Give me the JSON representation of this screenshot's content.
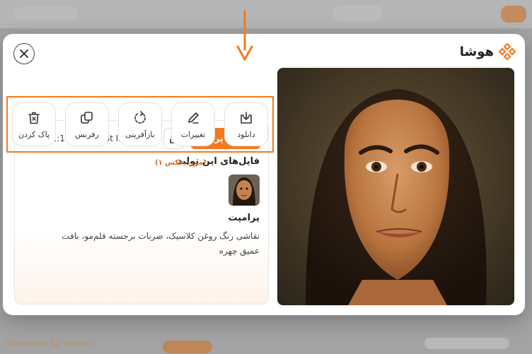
{
  "watermark": "Generated by Hoosha",
  "modal": {
    "logo_text": "هوشا",
    "toolbar": [
      {
        "icon": "download-icon",
        "label": "دانلود"
      },
      {
        "icon": "pencil-icon",
        "label": "تغییرات"
      },
      {
        "icon": "regenerate-icon",
        "label": "بازآفرینی"
      },
      {
        "icon": "reference-icon",
        "label": "رفرنس"
      },
      {
        "icon": "trash-icon",
        "label": "پاک کردن"
      }
    ],
    "copy_prompt_label": "کپی پرامپت",
    "meta": {
      "model": "Chatgpt Image 2.0",
      "ratio": "1:1",
      "resolution": "2K"
    },
    "files_title": "فایل‌های این تولید",
    "files_count": "(۱ مورد عکس)",
    "prompt_title": "پرامپت",
    "prompt_text": "نقاشی رنگ روغن کلاسیک، ضربات برجسته قلم‌مو، بافت عمیق چهره"
  },
  "colors": {
    "accent": "#f47a20"
  }
}
